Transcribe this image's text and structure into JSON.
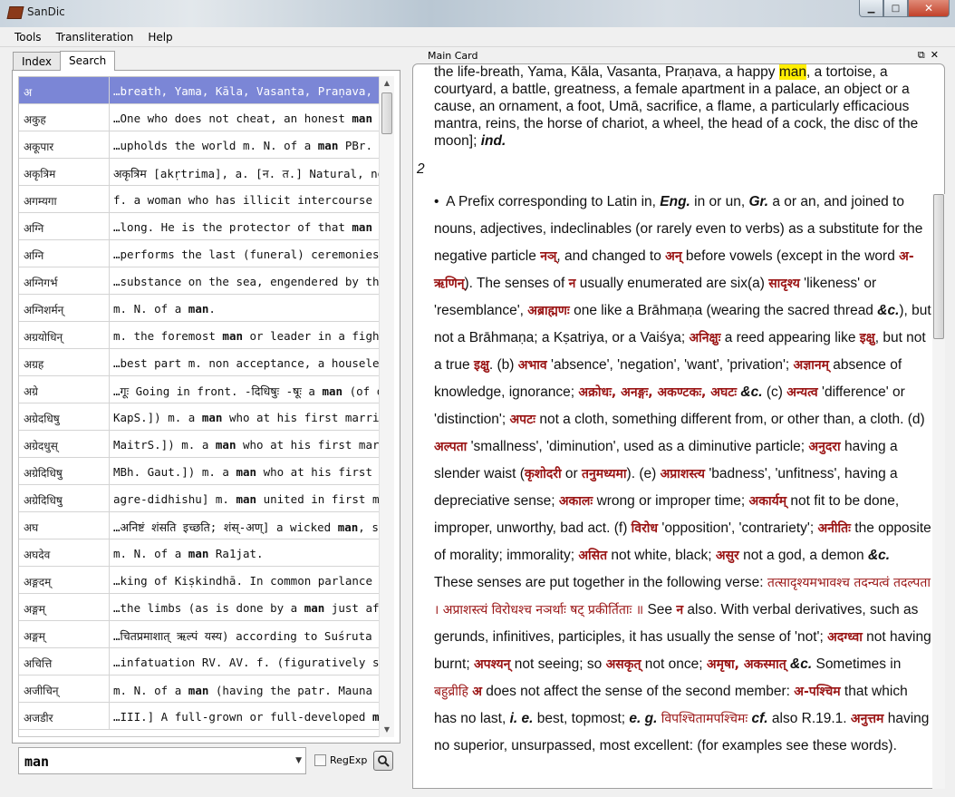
{
  "window": {
    "title": "SanDic",
    "min": "▁",
    "max": "□",
    "close": "✕"
  },
  "menu": [
    "Tools",
    "Transliteration",
    "Help"
  ],
  "tabs": {
    "index": "Index",
    "search": "Search"
  },
  "results": [
    {
      "word": "अ",
      "snippet": "…breath, Yama, Kāla, Vasanta, Praṇava, a",
      "bold": ""
    },
    {
      "word": "अकुह",
      "snippet": "…One who does not cheat, an honest ",
      "bold": "man"
    },
    {
      "word": "अकूपार",
      "snippet": "…upholds the world m. N. of a ",
      "bold": "man",
      "after": " PBr."
    },
    {
      "word": "अकृत्रिम",
      "snippet": "अकृत्रिम [akṛtrima], a. [न. त.] Natural, not ",
      "bold": "ma"
    },
    {
      "word": "अगम्यगा",
      "snippet": "f. a woman who has illicit intercourse with",
      "bold": ""
    },
    {
      "word": "अग्नि",
      "snippet": "…long. He is the protector of that ",
      "bold": "man",
      "after": " wh"
    },
    {
      "word": "अग्नि",
      "snippet": "…performs the last (funeral) ceremonies of",
      "bold": ""
    },
    {
      "word": "अग्निगर्भ",
      "snippet": "…substance on the sea, engendered by the",
      "bold": ""
    },
    {
      "word": "अग्निशर्मन्",
      "snippet": "m. N. of a ",
      "bold": "man",
      "after": "."
    },
    {
      "word": "अग्रयोधिन्",
      "snippet": "m. the foremost ",
      "bold": "man",
      "after": " or leader in a fight"
    },
    {
      "word": "अग्रह",
      "snippet": "…best part m. non acceptance, a houseless",
      "bold": ""
    },
    {
      "word": "अग्रे",
      "snippet": "…गूः Going in front. -दिधिषुः -षूः a ",
      "bold": "man",
      "after": " (of one"
    },
    {
      "word": "अग्रेदधिषु",
      "snippet": "KapS.]) m. a ",
      "bold": "man",
      "after": " who at his first marriag"
    },
    {
      "word": "अग्रेदधुस्",
      "snippet": "MaitrS.]) m. a ",
      "bold": "man",
      "after": " who at his first marria"
    },
    {
      "word": "अग्रेदिधिषु",
      "snippet": "MBh. Gaut.]) m. a ",
      "bold": "man",
      "after": " who at his first ma"
    },
    {
      "word": "अग्रेदिधिषु",
      "snippet": "agre-didhishu] m. ",
      "bold": "man",
      "after": " united in first marr"
    },
    {
      "word": "अघ",
      "snippet": "…अनिष्टं शंसति इच्छति; शंस्-अण्] a wicked ",
      "bold": "man",
      "after": ", s"
    },
    {
      "word": "अघदेव",
      "snippet": "m. N. of a ",
      "bold": "man",
      "after": " Ra1jat."
    },
    {
      "word": "अङ्गदम्",
      "snippet": "…king of Kiṣkindhā. In common parlance a",
      "bold": ""
    },
    {
      "word": "अङ्गम्",
      "snippet": "…the limbs (as is done by a ",
      "bold": "man",
      "after": " just after"
    },
    {
      "word": "अङ्गम्",
      "snippet": "…चितप्रमाशात् ऋल्पं यस्य) according to Suśruta a",
      "bold": ""
    },
    {
      "word": "अचित्ति",
      "snippet": "…infatuation RV. AV. f. (figuratively said of)",
      "bold": ""
    },
    {
      "word": "अजीचिन्",
      "snippet": "m. N. of a ",
      "bold": "man",
      "after": " (having the patr. Mauna मौ"
    },
    {
      "word": "अजडीर",
      "snippet": "…III.] A full-grown or full-developed ",
      "bold": "man",
      "after": ", a"
    }
  ],
  "search": {
    "query": "man",
    "regexp_label": "RegExp"
  },
  "main_card": {
    "title": "Main Card",
    "intro": [
      "the life-breath, Yama, Kāla, Vasanta, Praṇava, a happy ",
      "man",
      ", a tortoise, a courtyard, a battle, greatness, a female apartment in a palace, an object or a cause, an ornament, a foot, Umā, sacrifice, a flame, a particularly efficacious mantra, reins, the horse of chariot, a wheel, the head of a cock, the disc of the moon]; ",
      "ind."
    ],
    "sense_number": "2"
  }
}
